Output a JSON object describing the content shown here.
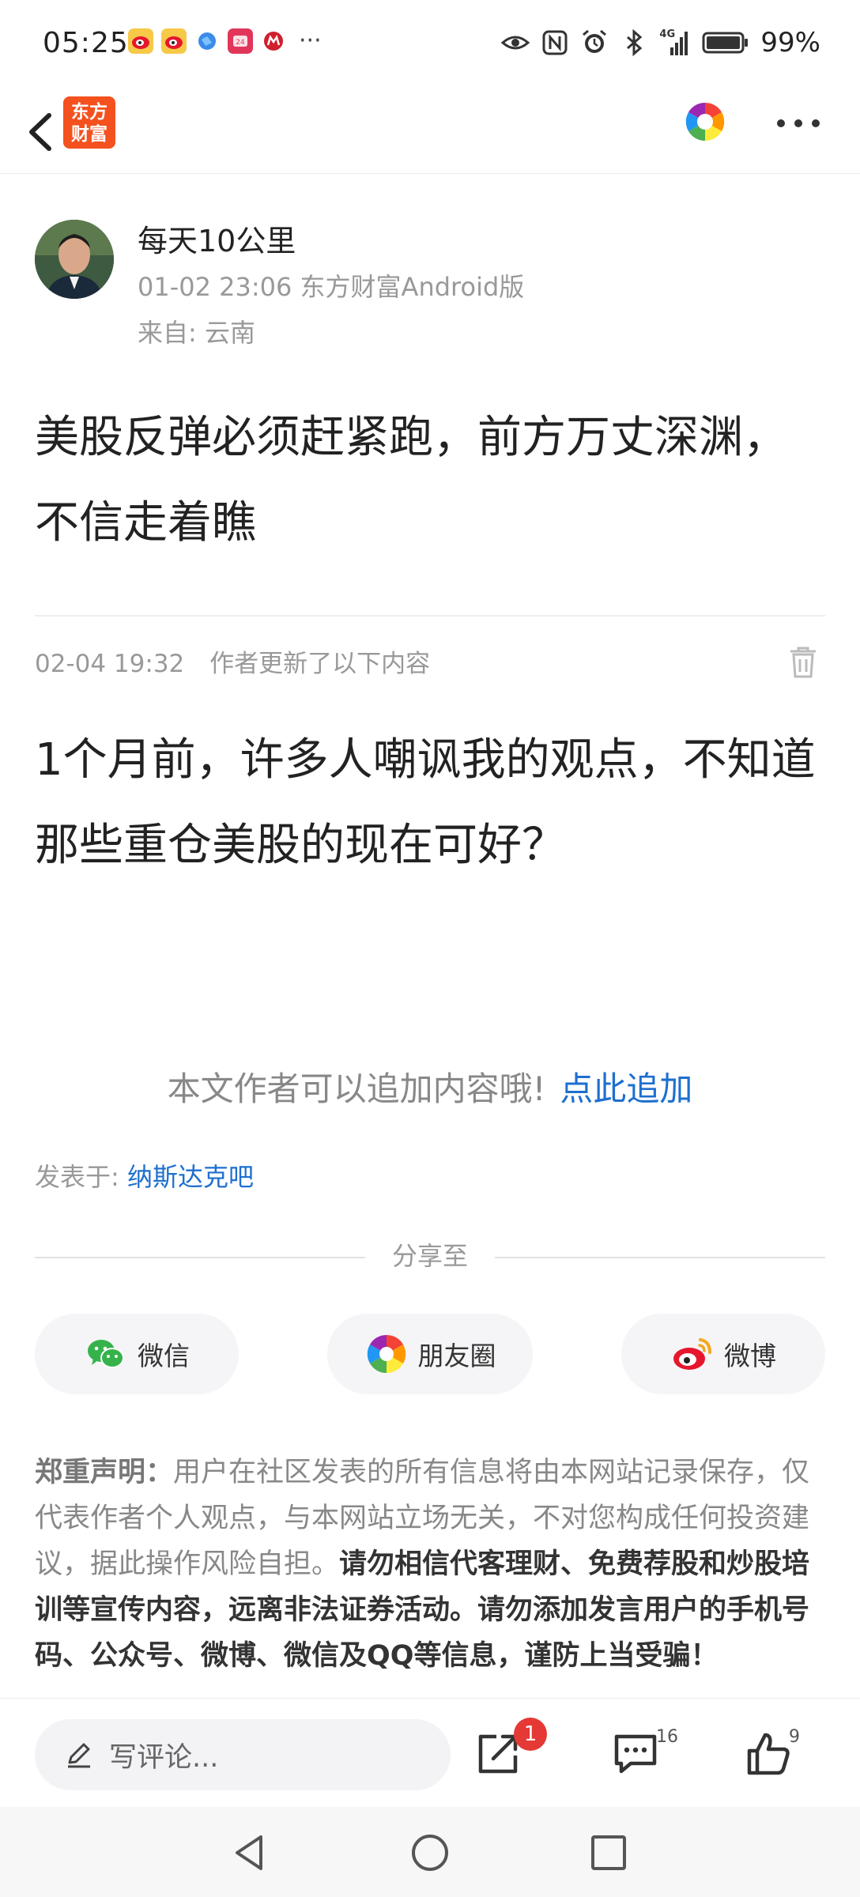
{
  "status_bar": {
    "time": "05:25",
    "battery": "99%",
    "more": "···",
    "network": "4G"
  },
  "header": {
    "app_logo_text": "东方财富"
  },
  "author": {
    "name": "每天10公里",
    "meta": "01-02 23:06 东方财富Android版",
    "location": "来自: 云南"
  },
  "post": {
    "title": "美股反弹必须赶紧跑，前方万丈深渊，不信走着瞧",
    "update_time": "02-04 19:32",
    "update_label": "作者更新了以下内容",
    "update_body": "1个月前，许多人嘲讽我的观点，不知道那些重仓美股的现在可好？"
  },
  "append": {
    "text": "本文作者可以追加内容哦!",
    "link": "点此追加"
  },
  "posted_in": {
    "label": "发表于:",
    "forum": "纳斯达克吧"
  },
  "share": {
    "title": "分享至",
    "buttons": [
      {
        "label": "微信",
        "icon": "wechat-icon"
      },
      {
        "label": "朋友圈",
        "icon": "moments-icon"
      },
      {
        "label": "微博",
        "icon": "weibo-icon"
      }
    ]
  },
  "disclaimer": {
    "heading": "郑重声明：",
    "normal": "用户在社区发表的所有信息将由本网站记录保存，仅代表作者个人观点，与本网站立场无关，不对您构成任何投资建议，据此操作风险自担。",
    "emphasis": "请勿相信代客理财、免费荐股和炒股培训等宣传内容，远离非法证券活动。请勿添加发言用户的手机号码、公众号、微博、微信及QQ等信息，谨防上当受骗！"
  },
  "action_bar": {
    "comment_placeholder": "写评论...",
    "share_badge": "1",
    "comment_count": "16",
    "like_count": "9"
  },
  "colors": {
    "accent_blue": "#1e6fcf",
    "brand_orange": "#f4511e",
    "badge_red": "#e53935"
  }
}
